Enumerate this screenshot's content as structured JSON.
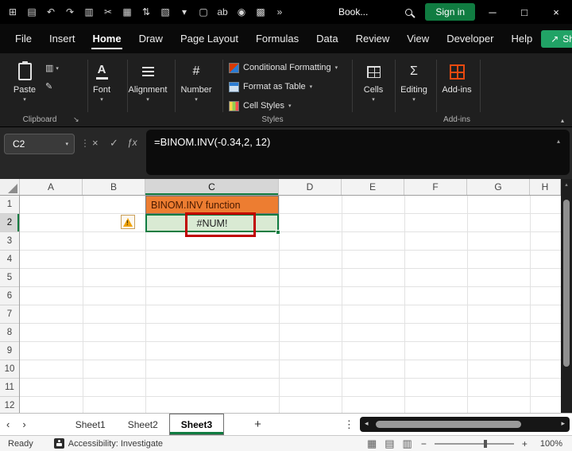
{
  "titlebar": {
    "qat": [
      {
        "name": "apps-icon",
        "glyph": "⊞"
      },
      {
        "name": "save-icon",
        "glyph": "▤"
      },
      {
        "name": "undo-icon",
        "glyph": "↶"
      },
      {
        "name": "redo-icon",
        "glyph": "↷"
      },
      {
        "name": "copy-icon",
        "glyph": "▥"
      },
      {
        "name": "cut-icon",
        "glyph": "✂"
      },
      {
        "name": "picture-icon",
        "glyph": "▦"
      },
      {
        "name": "sort-icon",
        "glyph": "⇅"
      },
      {
        "name": "borders-icon",
        "glyph": "▧"
      },
      {
        "name": "chevron-down-icon",
        "glyph": "▾"
      },
      {
        "name": "new-file-icon",
        "glyph": "▢"
      },
      {
        "name": "spelling-icon",
        "glyph": "ab"
      },
      {
        "name": "camera-icon",
        "glyph": "◉"
      },
      {
        "name": "table-icon",
        "glyph": "▩"
      },
      {
        "name": "more-commands-icon",
        "glyph": "»"
      }
    ],
    "document_title": "Book...",
    "sign_in_label": "Sign in"
  },
  "menubar": {
    "items": [
      "File",
      "Insert",
      "Home",
      "Draw",
      "Page Layout",
      "Formulas",
      "Data",
      "Review",
      "View",
      "Developer",
      "Help"
    ],
    "active_item": "Home",
    "share_label": "Share"
  },
  "ribbon": {
    "paste_label": "Paste",
    "clipboard_group_label": "Clipboard",
    "font_label": "Font",
    "alignment_label": "Alignment",
    "number_label": "Number",
    "styles": {
      "conditional_formatting": "Conditional Formatting",
      "format_as_table": "Format as Table",
      "cell_styles": "Cell Styles",
      "group_label": "Styles"
    },
    "cells_label": "Cells",
    "editing_label": "Editing",
    "addins_label": "Add-ins",
    "addins_group_label": "Add-ins"
  },
  "formula_bar": {
    "name_box": "C2",
    "formula": "=BINOM.INV(-0.34,2, 12)"
  },
  "grid": {
    "columns": [
      "A",
      "B",
      "C",
      "D",
      "E",
      "F",
      "G",
      "H"
    ],
    "rows": [
      "1",
      "2",
      "3",
      "4",
      "5",
      "6",
      "7",
      "8",
      "9",
      "10",
      "11",
      "12"
    ],
    "active_cell": "C2",
    "cells": {
      "C1": {
        "text": "BINOM.INV function",
        "fill": "#ED7D31"
      },
      "C2": {
        "text": "#NUM!",
        "fill": "#D9EAD3"
      }
    }
  },
  "sheet_tabs": {
    "tabs": [
      "Sheet1",
      "Sheet2",
      "Sheet3"
    ],
    "active_tab": "Sheet3",
    "add_label": "+"
  },
  "status_bar": {
    "ready_label": "Ready",
    "accessibility_label": "Accessibility: Investigate",
    "zoom_level": "100%"
  },
  "icons": {
    "chevron_down": "▾",
    "chevron_up": "▴",
    "ellipsis_v": "⋮",
    "cancel": "×",
    "enter": "✓",
    "fx": "ƒx",
    "font_glyph": "A",
    "number_glyph": "#",
    "editing_glyph": "Σ",
    "launcher": "↘",
    "brush": "✎",
    "copy_small": "▥",
    "minimize": "─",
    "maximize": "□",
    "close": "×",
    "share_arrow": "↗",
    "nav_left": "‹",
    "nav_right": "›",
    "scroll_left": "◂",
    "scroll_right": "▸",
    "scroll_up": "▴",
    "view_normal": "▦",
    "view_layout": "▤",
    "view_break": "▥",
    "zoom_out": "−",
    "zoom_in": "+",
    "warning_mark": "!"
  },
  "colors": {
    "accent_green": "#107C41",
    "share_green": "#21A366",
    "c1_fill": "#ED7D31",
    "c2_fill": "#D9EAD3",
    "annotation_red": "#C00000",
    "addins_orange": "#E8490F"
  }
}
